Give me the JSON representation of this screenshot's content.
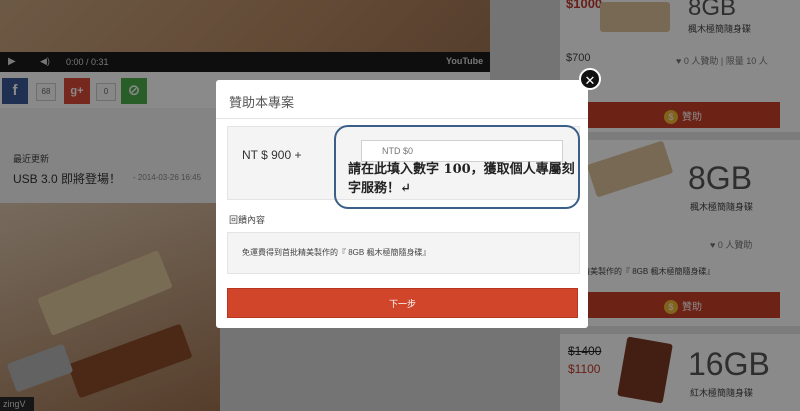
{
  "video": {
    "time": "0:00 / 0:31",
    "brand": "YouTube"
  },
  "share": {
    "facebook": {
      "glyph": "f",
      "count": "68"
    },
    "googleplus": {
      "glyph": "g+",
      "count": "0"
    },
    "link": {
      "glyph": "⊘"
    }
  },
  "updates": {
    "heading": "最近更新",
    "title": "USB 3.0 即將登場！",
    "date": "- 2014-03-26 16:45"
  },
  "right_cards": [
    {
      "old_price": "$1000",
      "size": "8GB",
      "name": "楓木極簡隨身碟",
      "price": "$700",
      "meta": "0 人贊助 | 限量 10 人",
      "button": "贊助"
    },
    {
      "size": "8GB",
      "name": "楓木極簡隨身碟",
      "meta": "0 人贊助",
      "note": "到首批精美製作的『 8GB 楓木極簡隨身碟』",
      "button": "贊助"
    },
    {
      "old_price": "$1400",
      "price": "$1100",
      "size": "16GB",
      "name": "紅木極簡隨身碟"
    }
  ],
  "modal": {
    "title": "贊助本專案",
    "amount_label": "NT $ 900 +",
    "amount_placeholder": "NTD $0",
    "reward_label": "回饋內容",
    "reward_text": "免運費得到首批精美製作的『 8GB 楓木極簡隨身碟』",
    "next_button": "下一步",
    "close_glyph": "✕"
  },
  "annotation": {
    "text": "請在此填入數字 100，獲取個人專屬刻字服務！↵"
  },
  "bottom_label": "zingV",
  "colors": {
    "accent_red": "#c9402a",
    "facebook": "#3b5998",
    "googleplus": "#dd4b39",
    "link_green": "#4cae4c",
    "callout_border": "#3b5f86"
  }
}
